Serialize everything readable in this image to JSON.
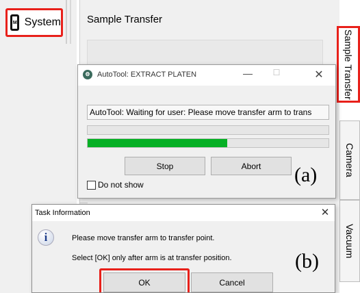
{
  "nav": {
    "system_label": "System",
    "system_icon_text": "M"
  },
  "panel": {
    "title": "Sample Transfer"
  },
  "tabs": [
    {
      "label": "Sample Transfer",
      "selected": true
    },
    {
      "label": "Camera"
    },
    {
      "label": "Vacuum"
    }
  ],
  "autotool_dialog": {
    "title": "AutoTool: EXTRACT PLATEN",
    "min_glyph": "—",
    "max_glyph": "☐",
    "close_glyph": "✕",
    "message": "AutoTool: Waiting for user: Please move transfer arm to trans",
    "progress_fraction": 0.58,
    "stop_label": "Stop",
    "abort_label": "Abort",
    "annotation": "(a)",
    "checkbox_label": "Do not show",
    "checkbox_checked": false
  },
  "task_dialog": {
    "title": "Task Information",
    "close_glyph": "✕",
    "info_icon": "i",
    "line1": "Please move transfer arm to transfer point.",
    "line2": "Select [OK] only after arm is at transfer position.",
    "annotation": "(b)",
    "ok_label": "OK",
    "cancel_label": "Cancel"
  },
  "colors": {
    "highlight": "#e8201a",
    "progress": "#06b025"
  }
}
